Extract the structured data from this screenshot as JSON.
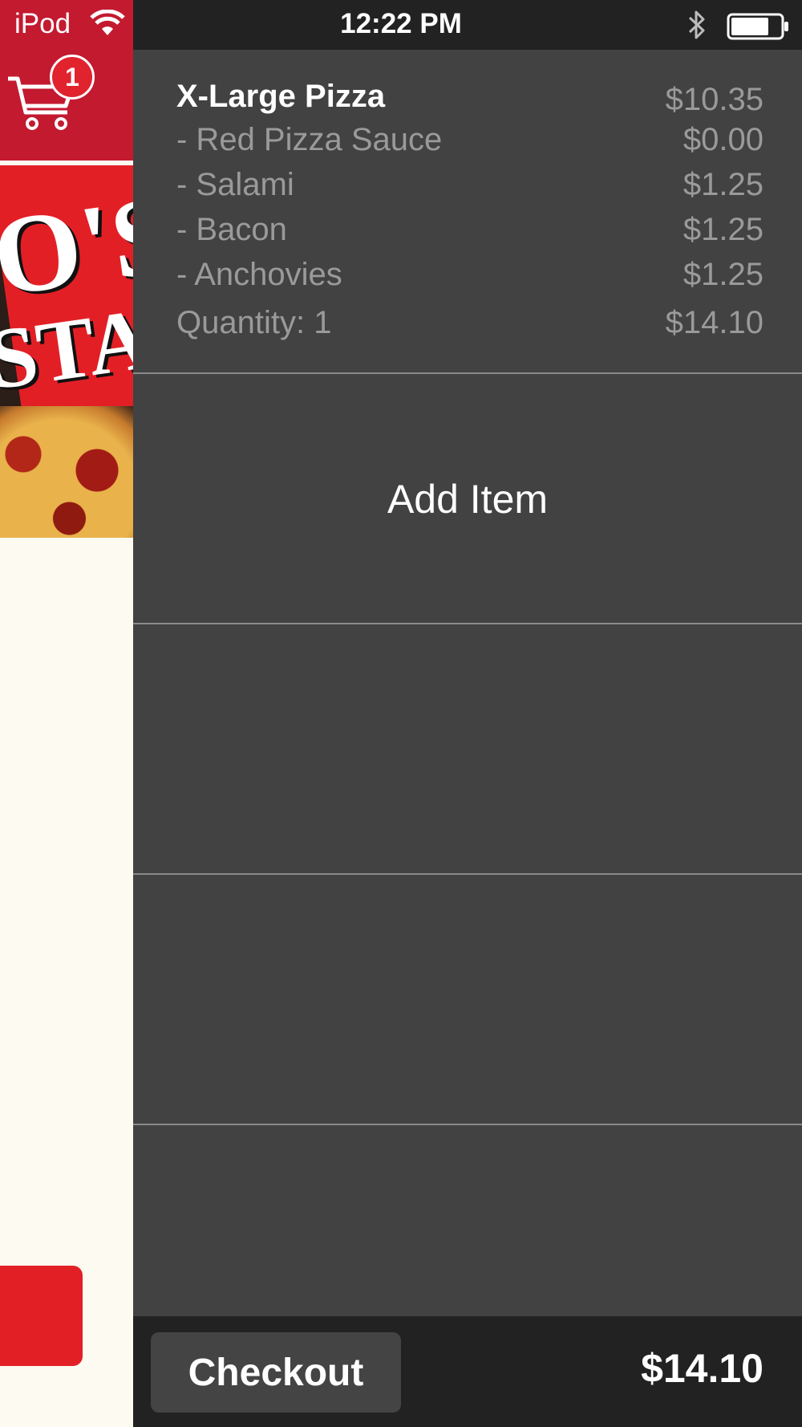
{
  "status_bar": {
    "carrier": "iPod",
    "time": "12:22 PM"
  },
  "cart_icon": {
    "badge_count": "1"
  },
  "brand_banner": {
    "line1": "O'S",
    "line2": "STA"
  },
  "order": {
    "item": {
      "name": "X-Large Pizza",
      "price": "$10.35"
    },
    "toppings": [
      {
        "label": " - Red Pizza Sauce",
        "price": "$0.00"
      },
      {
        "label": " - Salami",
        "price": "$1.25"
      },
      {
        "label": " - Bacon",
        "price": "$1.25"
      },
      {
        "label": " - Anchovies",
        "price": "$1.25"
      }
    ],
    "quantity": {
      "label": "Quantity: 1",
      "price": "$14.10"
    }
  },
  "add_item_label": "Add Item",
  "footer": {
    "checkout_label": "Checkout",
    "total": "$14.10"
  },
  "colors": {
    "panel_bg": "#424242",
    "bar_bg": "#222222",
    "brand_red": "#e31f26",
    "muted_text": "#9a9a9a"
  }
}
